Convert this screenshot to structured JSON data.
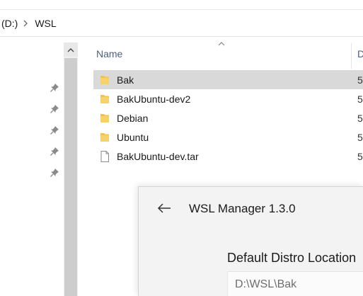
{
  "explorer": {
    "breadcrumb": [
      {
        "label": "(D:)"
      },
      {
        "label": "WSL"
      }
    ],
    "columns": {
      "name": "Name",
      "date": "D"
    },
    "files": [
      {
        "name": "Bak",
        "type": "folder",
        "date": "5",
        "selected": true
      },
      {
        "name": "BakUbuntu-dev2",
        "type": "folder",
        "date": "5",
        "selected": false
      },
      {
        "name": "Debian",
        "type": "folder",
        "date": "5",
        "selected": false
      },
      {
        "name": "Ubuntu",
        "type": "folder",
        "date": "5",
        "selected": false
      },
      {
        "name": "BakUbuntu-dev.tar",
        "type": "file",
        "date": "5",
        "selected": false
      }
    ],
    "pinned_count": 5,
    "icons": {
      "pin": "pin-icon",
      "folder": "folder-icon",
      "file": "file-icon"
    }
  },
  "wsl_manager": {
    "title": "WSL Manager 1.3.0",
    "location_label": "Default Distro Location",
    "location_value": "D:\\WSL\\Bak"
  },
  "colors": {
    "folder": "#f2c24f",
    "selected_row": "#d9d9d9",
    "header_text": "#4c607a"
  }
}
